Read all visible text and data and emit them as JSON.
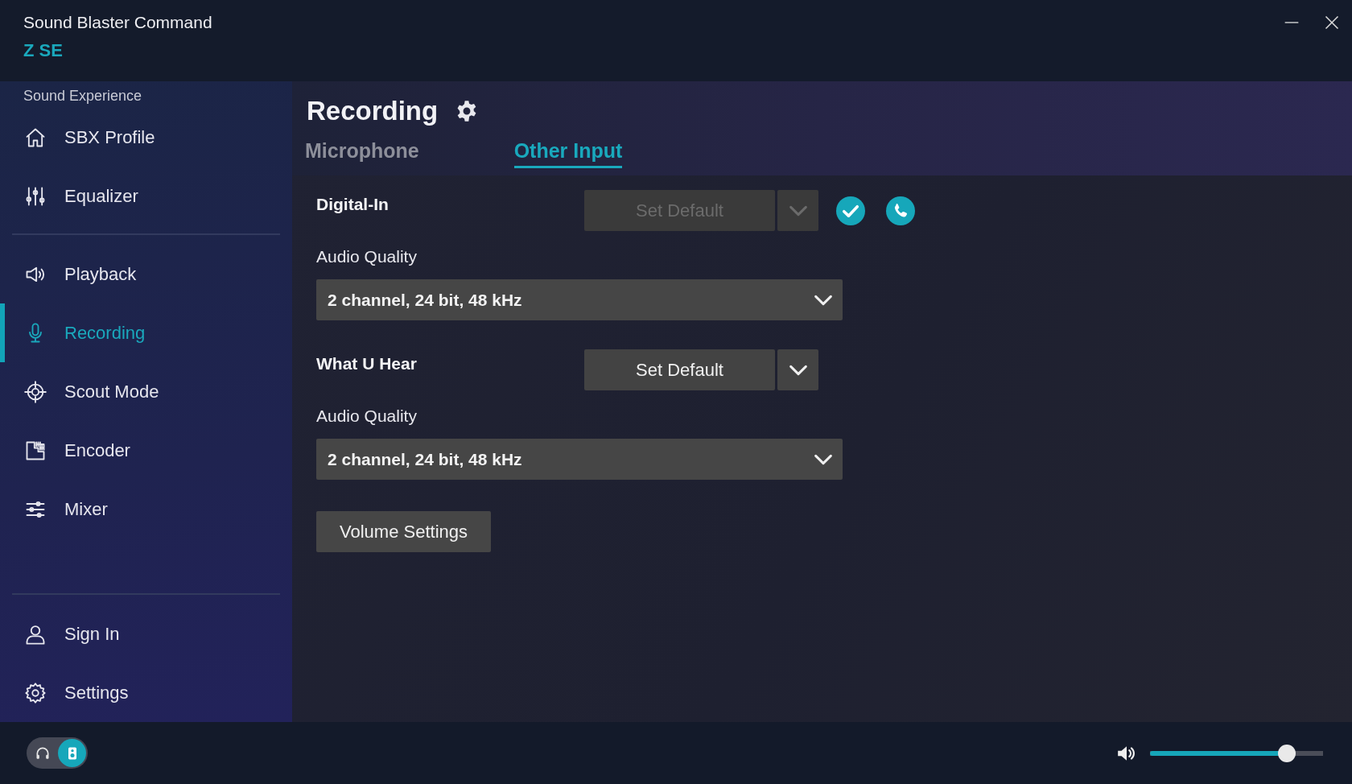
{
  "window": {
    "title": "Sound Blaster Command",
    "device": "Z SE"
  },
  "sidebar": {
    "section": "Sound Experience",
    "groups": [
      [
        {
          "kind": "home",
          "label": "SBX Profile",
          "selected": false
        },
        {
          "kind": "equalizer",
          "label": "Equalizer",
          "selected": false
        }
      ],
      [
        {
          "kind": "playback",
          "label": "Playback",
          "selected": false
        },
        {
          "kind": "recording",
          "label": "Recording",
          "selected": true
        },
        {
          "kind": "scout",
          "label": "Scout Mode",
          "selected": false
        },
        {
          "kind": "encoder",
          "label": "Encoder",
          "selected": false
        },
        {
          "kind": "mixer",
          "label": "Mixer",
          "selected": false
        }
      ],
      [
        {
          "kind": "user",
          "label": "Sign In",
          "selected": false
        },
        {
          "kind": "settings",
          "label": "Settings",
          "selected": false
        }
      ]
    ]
  },
  "page": {
    "title": "Recording",
    "tabs": [
      {
        "label": "Microphone",
        "selected": false
      },
      {
        "label": "Other Input",
        "selected": true
      }
    ]
  },
  "devices": [
    {
      "name": "Digital-In",
      "set_default": "Set Default",
      "disabled": true,
      "default_device": true,
      "default_communication": true,
      "quality_label": "Audio Quality",
      "quality": "2 channel, 24 bit, 48 kHz"
    },
    {
      "name": "What U Hear",
      "set_default": "Set Default",
      "disabled": false,
      "default_device": false,
      "default_communication": false,
      "quality_label": "Audio Quality",
      "quality": "2 channel, 24 bit, 48 kHz"
    }
  ],
  "volume_settings": "Volume Settings",
  "bottom_bar": {
    "outputs": [
      {
        "kind": "headphones",
        "selected": false
      },
      {
        "kind": "speakers",
        "selected": true
      }
    ],
    "volume": {
      "level": 0.79
    }
  }
}
